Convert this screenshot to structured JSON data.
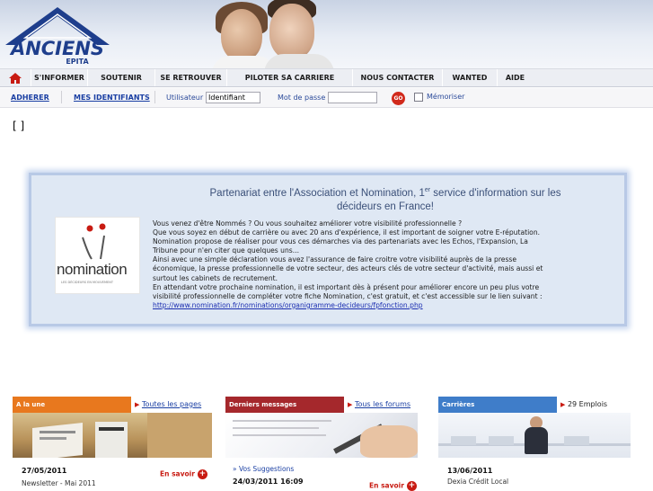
{
  "header": {
    "logo_text": "ANCIENS",
    "logo_subtext": "EPITA"
  },
  "nav": {
    "items": [
      "S'INFORMER",
      "SOUTENIR",
      "SE RETROUVER",
      "PILOTER SA CARRIERE",
      "NOUS CONTACTER",
      "WANTED",
      "AIDE"
    ]
  },
  "login": {
    "adherer": "ADHERER",
    "identifiants": "MES IDENTIFIANTS",
    "user_label": "Utilisateur",
    "user_value": "Identifiant",
    "password_label": "Mot de passe",
    "go": "GO",
    "remember": "Mémoriser"
  },
  "brackets": "[ ]",
  "partner": {
    "title_line1_a": "Partenariat entre l'Association et Nomination, 1",
    "title_sup": "er",
    "title_line1_b": " service d'information sur les",
    "title_line2": "décideurs en France!",
    "logo_word": "nomination",
    "logo_tagline": "LES DÉCIDEURS EN MOUVEMENT",
    "paragraphs": [
      "Vous venez d'être  Nommés  ? Ou vous souhaitez améliorer votre visibilité professionnelle ?",
      "Que vous soyez en début de carrière ou avec 20 ans d'expérience,  il est important de soigner votre E-réputation.",
      "Nomination propose de réaliser pour vous ces démarches via des partenariats avec les Echos, l'Expansion, La",
      "Tribune pour n'en citer que quelques uns...",
      "Ainsi avec une simple déclaration vous avez l'assurance de faire croitre votre visibilité auprès de la presse",
      "économique,  la presse professionnelle de votre secteur,  des acteurs clés de votre secteur d'activité, mais aussi et",
      "surtout les cabinets de recrutement.",
      "En attendant votre prochaine nomination, il est important dès à présent pour améliorer encore un peu plus votre",
      "visibilité professionnelle de compléter votre fiche Nomination, c'est gratuit, et c'est accessible sur le lien suivant :"
    ],
    "link": "http://www.nomination.fr/nominations/organigramme-decideurs/fpfonction.php"
  },
  "columns": {
    "une": {
      "header": "A la une",
      "more": "Toutes les pages",
      "date": "27/05/2011",
      "sub": "Newsletter - Mai 2011",
      "ensavoir": "En savoir",
      "color": "#e8781e"
    },
    "messages": {
      "header": "Derniers messages",
      "more": "Tous les forums",
      "link": "» Vos Suggestions",
      "date": "24/03/2011 16:09",
      "ensavoir": "En savoir",
      "color": "#a5282c"
    },
    "carrieres": {
      "header": "Carrières",
      "more": "29 Emplois",
      "date": "13/06/2011",
      "sub": "Dexia Crédit Local",
      "color": "#3f7dc9"
    }
  }
}
